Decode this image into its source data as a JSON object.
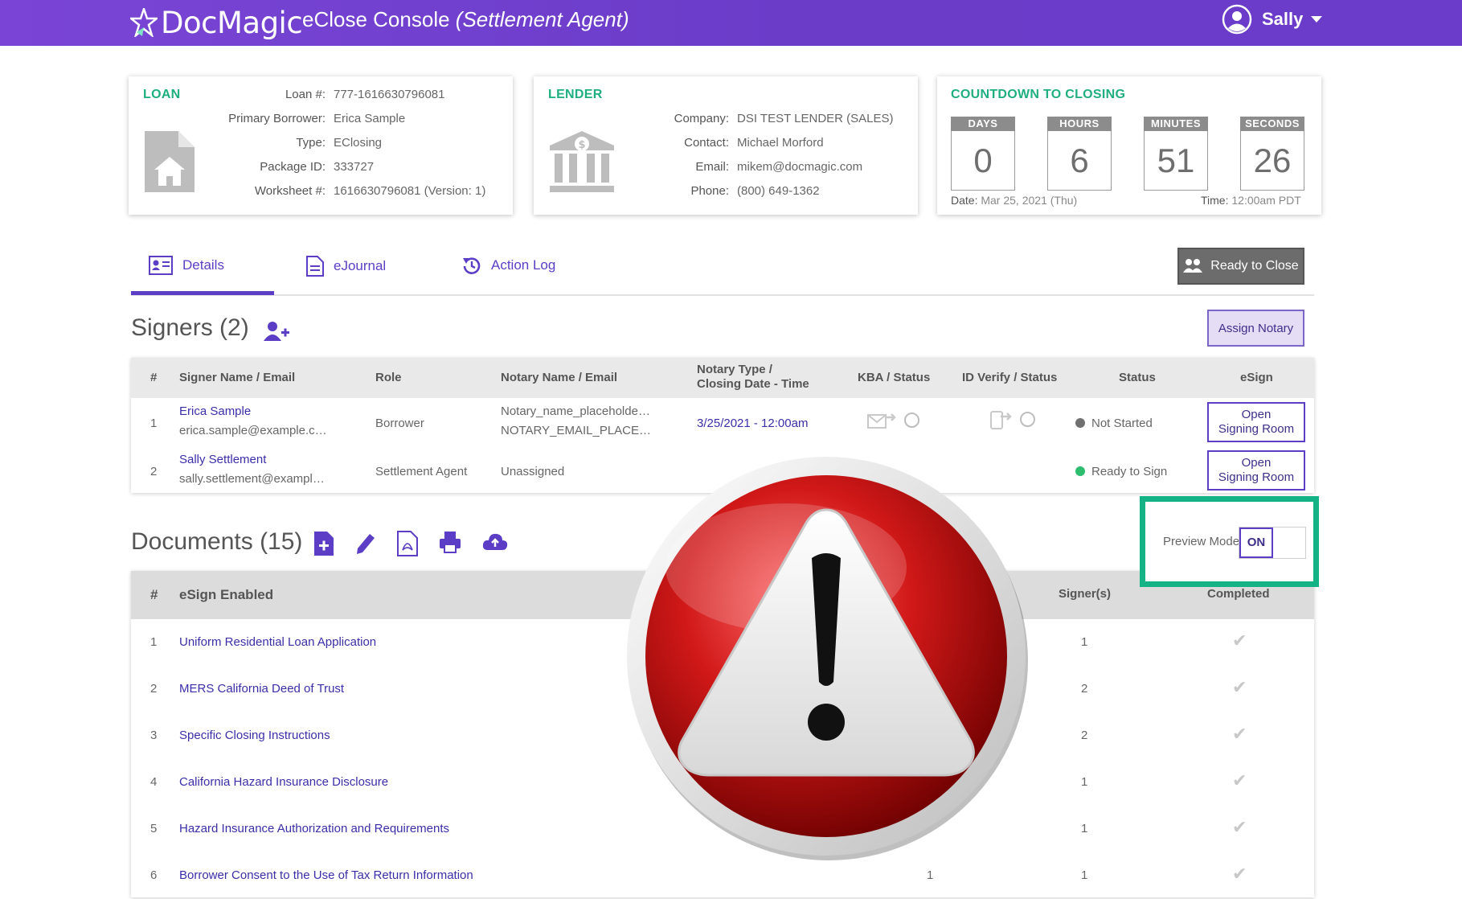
{
  "header": {
    "logo": "DocMagic",
    "title": "eClose Console",
    "title_role": "(Settlement Agent)",
    "user": "Sally"
  },
  "loan": {
    "heading": "LOAN",
    "fields": [
      {
        "label": "Loan #:",
        "value": "777-1616630796081"
      },
      {
        "label": "Primary Borrower:",
        "value": "Erica Sample"
      },
      {
        "label": "Type:",
        "value": "EClosing"
      },
      {
        "label": "Package ID:",
        "value": "333727"
      },
      {
        "label": "Worksheet #:",
        "value": "1616630796081 (Version: 1)"
      }
    ]
  },
  "lender": {
    "heading": "LENDER",
    "fields": [
      {
        "label": "Company:",
        "value": "DSI TEST LENDER (SALES)"
      },
      {
        "label": "Contact:",
        "value": "Michael Morford"
      },
      {
        "label": "Email:",
        "value": "mikem@docmagic.com"
      },
      {
        "label": "Phone:",
        "value": "(800) 649-1362"
      }
    ]
  },
  "countdown": {
    "heading": "COUNTDOWN TO CLOSING",
    "units": [
      {
        "label": "DAYS",
        "value": "0"
      },
      {
        "label": "HOURS",
        "value": "6"
      },
      {
        "label": "MINUTES",
        "value": "51"
      },
      {
        "label": "SECONDS",
        "value": "26"
      }
    ],
    "date_label": "Date:",
    "date_value": "Mar 25, 2021 (Thu)",
    "time_label": "Time:",
    "time_value": "12:00am PDT"
  },
  "tabs": [
    {
      "label": "Details",
      "active": true
    },
    {
      "label": "eJournal"
    },
    {
      "label": "Action Log"
    }
  ],
  "ready_button": "Ready to Close",
  "signers": {
    "title": "Signers (2)",
    "assign_button": "Assign Notary",
    "columns": [
      "#",
      "Signer Name / Email",
      "Role",
      "Notary Name / Email",
      "Notary Type /",
      "Closing Date - Time",
      "KBA / Status",
      "ID Verify / Status",
      "Status",
      "eSign"
    ],
    "rows": [
      {
        "num": "1",
        "name": "Erica Sample",
        "email": "erica.sample@example.c…",
        "role": "Borrower",
        "notary_name": "Notary_name_placeholde…",
        "notary_email": "NOTARY_EMAIL_PLACE…",
        "closing": "3/25/2021 - 12:00am",
        "status": "Not Started",
        "status_color": "#6f6f6f",
        "esign_line1": "Open",
        "esign_line2": "Signing Room"
      },
      {
        "num": "2",
        "name": "Sally Settlement",
        "email": "sally.settlement@exampl…",
        "role": "Settlement Agent",
        "notary_name": "Unassigned",
        "notary_email": "",
        "closing": "",
        "status": "Ready to Sign",
        "status_color": "#2dbd6e",
        "esign_line1": "Open",
        "esign_line2": "Signing Room"
      }
    ]
  },
  "documents": {
    "title": "Documents (15)",
    "preview_label": "Preview Mode",
    "preview_state": "ON",
    "columns": [
      "#",
      "eSign Enabled",
      "Signer(s)",
      "Completed"
    ],
    "rows": [
      {
        "num": "1",
        "name": "Uniform Residential Loan Application",
        "signers": "1",
        "extra": ""
      },
      {
        "num": "2",
        "name": "MERS California Deed of Trust",
        "signers": "2",
        "extra": ""
      },
      {
        "num": "3",
        "name": "Specific Closing Instructions",
        "signers": "2",
        "extra": ""
      },
      {
        "num": "4",
        "name": "California Hazard Insurance Disclosure",
        "signers": "1",
        "extra": ""
      },
      {
        "num": "5",
        "name": "Hazard Insurance Authorization and Requirements",
        "signers": "1",
        "extra": ""
      },
      {
        "num": "6",
        "name": "Borrower Consent to the Use of Tax Return Information",
        "signers": "1",
        "extra": "1"
      }
    ]
  },
  "colors": {
    "brand_purple": "#6a3cc8",
    "accent_green": "#13b386",
    "link_blue": "#3a2fa8"
  }
}
